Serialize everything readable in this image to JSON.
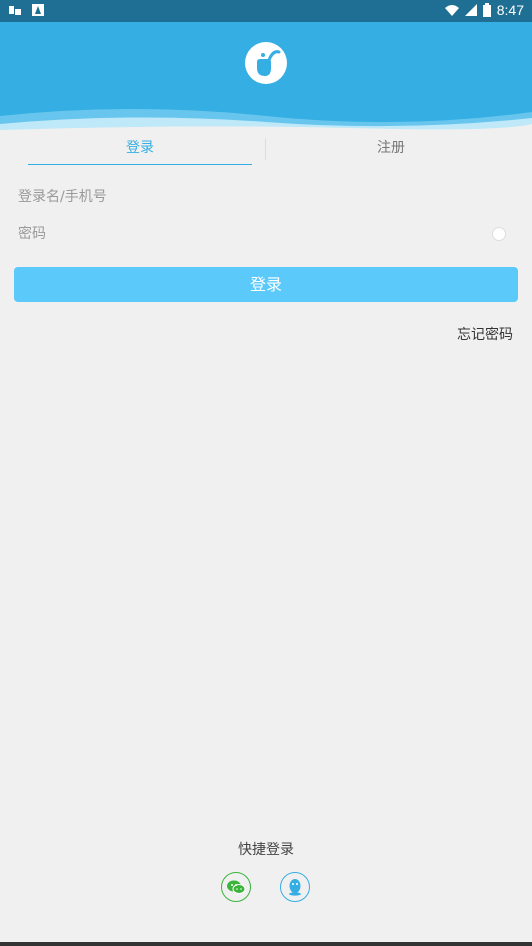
{
  "status_bar": {
    "time": "8:47"
  },
  "tabs": {
    "login": "登录",
    "register": "注册"
  },
  "form": {
    "username_placeholder": "登录名/手机号",
    "password_placeholder": "密码",
    "login_button": "登录",
    "forgot_password": "忘记密码"
  },
  "quick_login": {
    "title": "快捷登录",
    "options": [
      "wechat-icon",
      "qq-icon"
    ]
  },
  "colors": {
    "primary": "#35aee3",
    "button": "#5cc9fb",
    "wechat": "#3ab53a",
    "background": "#f0f0f0"
  }
}
